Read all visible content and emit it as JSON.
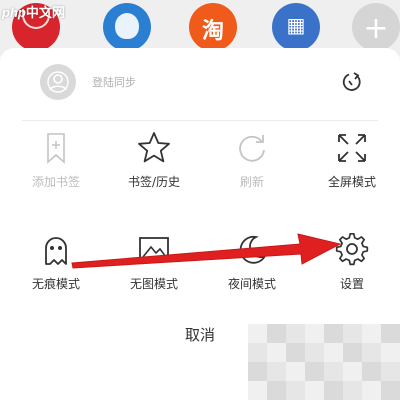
{
  "watermark": {
    "php": "php",
    "cn": "中文网"
  },
  "top_apps": [
    {
      "icon": "app-red-icon",
      "glyph": ""
    },
    {
      "icon": "app-dolphin-icon",
      "glyph": ""
    },
    {
      "icon": "app-taobao-icon",
      "glyph": "淘"
    },
    {
      "icon": "app-building-icon",
      "glyph": ""
    },
    {
      "icon": "add-app-icon",
      "glyph": "+"
    }
  ],
  "login": {
    "label": "登陆同步"
  },
  "menu": {
    "row1": [
      {
        "label": "添加书签",
        "icon": "bookmark-add-icon",
        "enabled": false
      },
      {
        "label": "书签/历史",
        "icon": "star-icon",
        "enabled": true
      },
      {
        "label": "刷新",
        "icon": "refresh-icon",
        "enabled": false
      },
      {
        "label": "全屏模式",
        "icon": "fullscreen-icon",
        "enabled": true
      }
    ],
    "row2": [
      {
        "label": "无痕模式",
        "icon": "ghost-icon",
        "enabled": true
      },
      {
        "label": "无图模式",
        "icon": "no-image-icon",
        "enabled": true
      },
      {
        "label": "夜间模式",
        "icon": "moon-icon",
        "enabled": true
      },
      {
        "label": "设置",
        "icon": "gear-icon",
        "enabled": true
      }
    ]
  },
  "cancel_label": "取消",
  "colors": {
    "accent_arrow": "#e02020",
    "text": "#333333",
    "disabled": "#bcbcbc"
  }
}
